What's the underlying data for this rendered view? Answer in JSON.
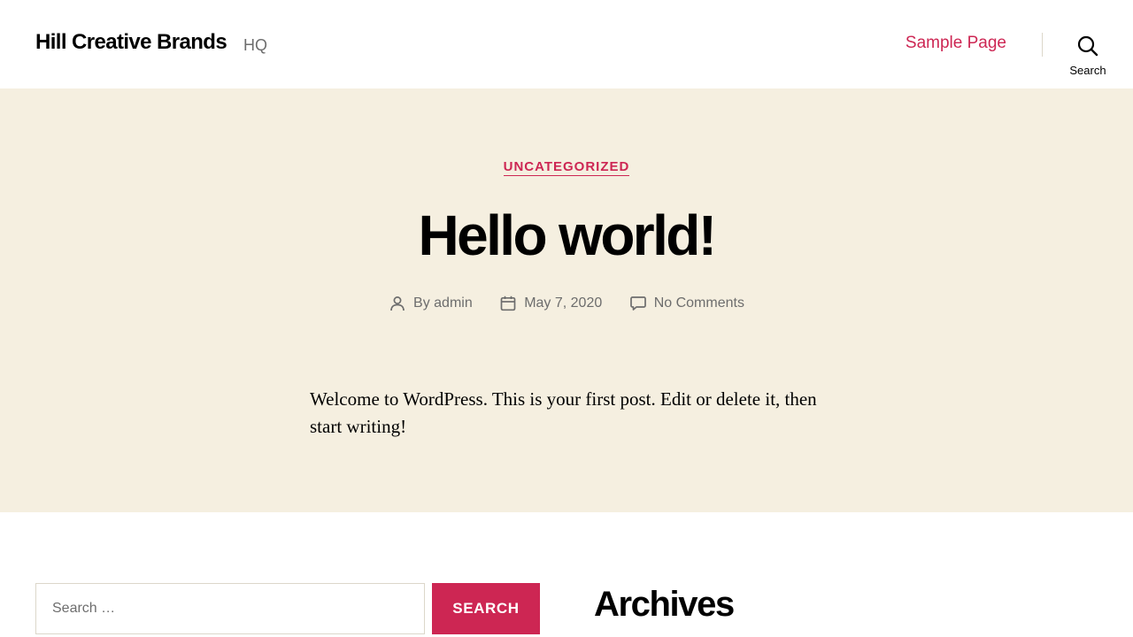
{
  "header": {
    "site_title": "Hill Creative Brands",
    "tagline": "HQ",
    "nav_items": [
      {
        "label": "Sample Page"
      }
    ],
    "search_label": "Search"
  },
  "post": {
    "category": "UNCATEGORIZED",
    "title": "Hello world!",
    "meta": {
      "author": "By admin",
      "date": "May 7, 2020",
      "comments": "No Comments"
    },
    "content": "Welcome to WordPress. This is your first post. Edit or delete it, then start writing!"
  },
  "widgets": {
    "search": {
      "placeholder": "Search …",
      "button_label": "SEARCH"
    },
    "archives_title": "Archives"
  },
  "colors": {
    "accent": "#cd2653",
    "hero_background": "#f5efe0",
    "secondary_text": "#6d6d6d",
    "border": "#dcd7ca"
  },
  "icons": {
    "search": "search-icon",
    "author": "user-icon",
    "date": "calendar-icon",
    "comments": "comment-icon"
  }
}
